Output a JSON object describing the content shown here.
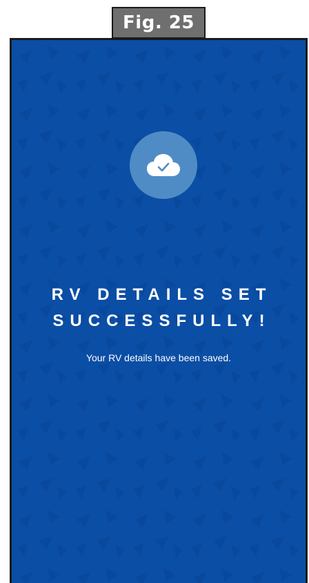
{
  "figure": {
    "label": "Fig. 25"
  },
  "screen": {
    "background_color": "#0b4ea5",
    "icon": "cloud-check-icon",
    "headline_line1": "RV DETAILS SET",
    "headline_line2": "SUCCESSFULLY!",
    "message": "Your RV details have been saved."
  }
}
